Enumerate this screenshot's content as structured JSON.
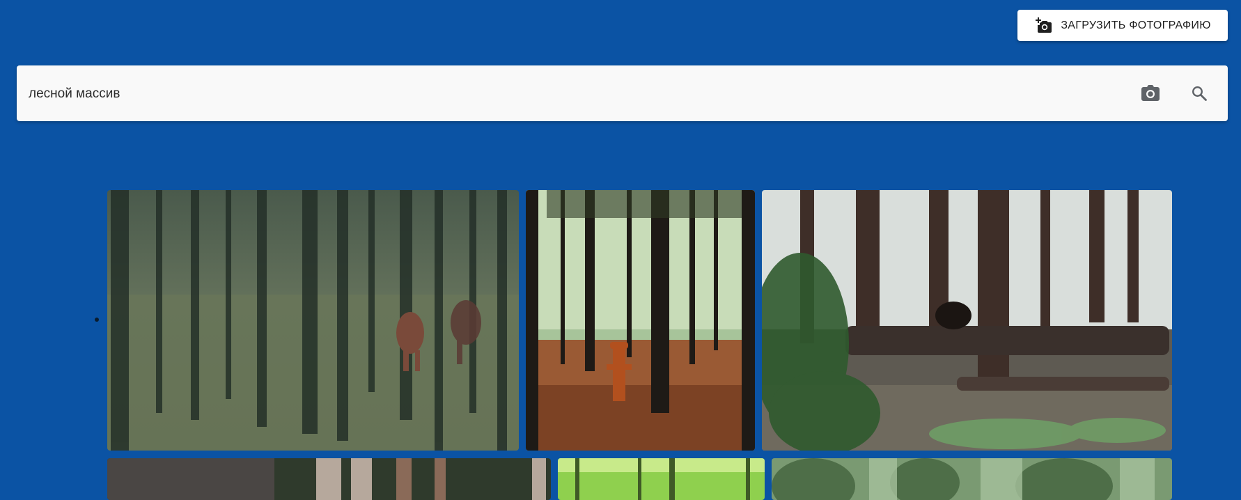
{
  "header": {
    "upload_label": "ЗАГРУЗИТЬ ФОТОГРАФИЮ",
    "upload_icon": "add-a-photo-icon"
  },
  "search": {
    "value": "лесной массив",
    "camera_icon": "camera-icon",
    "search_icon": "search-icon"
  },
  "gallery": {
    "rows": [
      {
        "photos": [
          {
            "subject": "blurred forest with two cows grazing"
          },
          {
            "subject": "pine forest with rusty fire hydrant"
          },
          {
            "subject": "redwood forest with black bear near fallen log"
          }
        ]
      },
      {
        "photos": [
          {
            "subject": "forest trunks (partially visible)"
          },
          {
            "subject": "bright green forest (partially visible)"
          },
          {
            "subject": "green conifer forest (partially visible)"
          }
        ]
      }
    ]
  },
  "colors": {
    "background": "#0b53a4",
    "search_bar": "#f9f9f9",
    "button": "#ffffff"
  }
}
